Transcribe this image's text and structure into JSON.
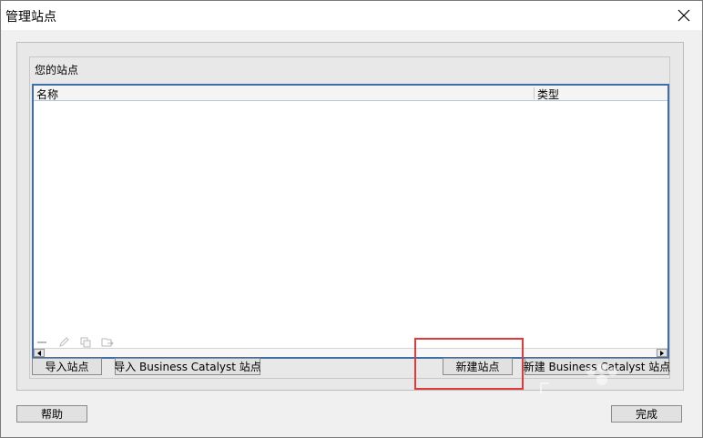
{
  "window": {
    "title": "管理站点",
    "close_symbol": "✕"
  },
  "sites": {
    "group_title": "您的站点",
    "columns": {
      "name": "名称",
      "type": "类型"
    },
    "rows": []
  },
  "toolbar_icons": [
    "minus-icon",
    "pencil-icon",
    "duplicate-icon",
    "export-icon"
  ],
  "buttons": {
    "import_site": "导入站点",
    "import_bc": "导入 Business Catalyst 站点",
    "new_site": "新建站点",
    "new_bc": "新建 Business Catalyst 站点",
    "help": "帮助",
    "done": "完成"
  },
  "colors": {
    "highlight": "#e23a3a",
    "list_border": "#3f6ea8"
  }
}
